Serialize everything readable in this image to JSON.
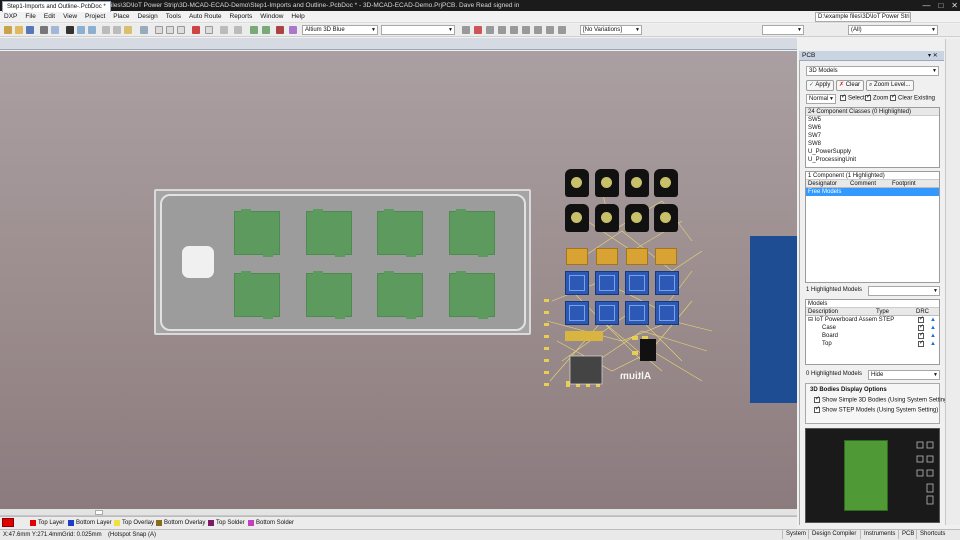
{
  "window": {
    "title": "Altium Designer (13.3) - D:\\example files\\3D\\IoT Power Strip\\3D-MCAD-ECAD-Demo\\Step1-Imports and Outline-.PcbDoc * - 3D-MCAD-ECAD-Demo.PrjPCB. Dave Read signed in"
  },
  "menu": {
    "items": [
      "DXP",
      "File",
      "Edit",
      "View",
      "Project",
      "Place",
      "Design",
      "Tools",
      "Auto Route",
      "Reports",
      "Window",
      "Help"
    ],
    "path_field": "D:\\example files\\3D\\IoT Power Strip"
  },
  "toolbar": {
    "view_config": "Altium 3D Blue",
    "variations": "[No Variations]",
    "filter_all": "(All)"
  },
  "document": {
    "tab_label": "Step1-Imports and Outline-.PcbDoc *"
  },
  "canvas": {
    "silk_text": "Altium"
  },
  "layers": {
    "tabs": [
      {
        "label": "Top Layer",
        "color": "#e00000"
      },
      {
        "label": "Bottom Layer",
        "color": "#1f3cc8"
      },
      {
        "label": "Top Overlay",
        "color": "#f0e040"
      },
      {
        "label": "Bottom Overlay",
        "color": "#8a6d1a"
      },
      {
        "label": "Top Solder",
        "color": "#7a1a6a"
      },
      {
        "label": "Bottom Solder",
        "color": "#c040c0"
      }
    ]
  },
  "status": {
    "coords": "X:47.6mm Y:271.4mm",
    "grid": "Grid: 0.025mm",
    "snap": "(Hotspot Snap (A)",
    "buttons": [
      "System",
      "Design Compiler",
      "Instruments",
      "PCB",
      "Shortcuts"
    ]
  },
  "panel": {
    "title": "PCB",
    "mode": "3D Models",
    "apply_label": "Apply",
    "clear_label": "Clear",
    "zoom_label": "Zoom Level...",
    "normal_label": "Normal",
    "select_label": "Select",
    "zoom_check_label": "Zoom",
    "clear_existing_label": "Clear Existing",
    "classes_header": "24 Component Classes (0 Highlighted)",
    "classes": [
      "SW5",
      "SW6",
      "SW7",
      "SW8",
      "U_PowerSupply",
      "U_ProcessingUnit"
    ],
    "components_header": "1 Component (1 Highlighted)",
    "comp_columns": [
      "Designator",
      "Comment",
      "Footprint"
    ],
    "comp_selected": "Free Models",
    "highlighted_models": "1 Highlighted Models",
    "models_header": "Models",
    "model_columns": [
      "Description",
      "Type",
      "DRC"
    ],
    "model_root": "IoT Powerboard Assem STEP",
    "model_children": [
      "Case",
      "Board",
      "Top"
    ],
    "zero_highlighted": "0 Highlighted Models",
    "hide_label": "Hide",
    "bodies_title": "3D Bodies Display Options",
    "bodies_opt1": "Show Simple 3D Bodies (Using System Setting)",
    "bodies_opt2": "Show STEP Models (Using System Setting)"
  }
}
